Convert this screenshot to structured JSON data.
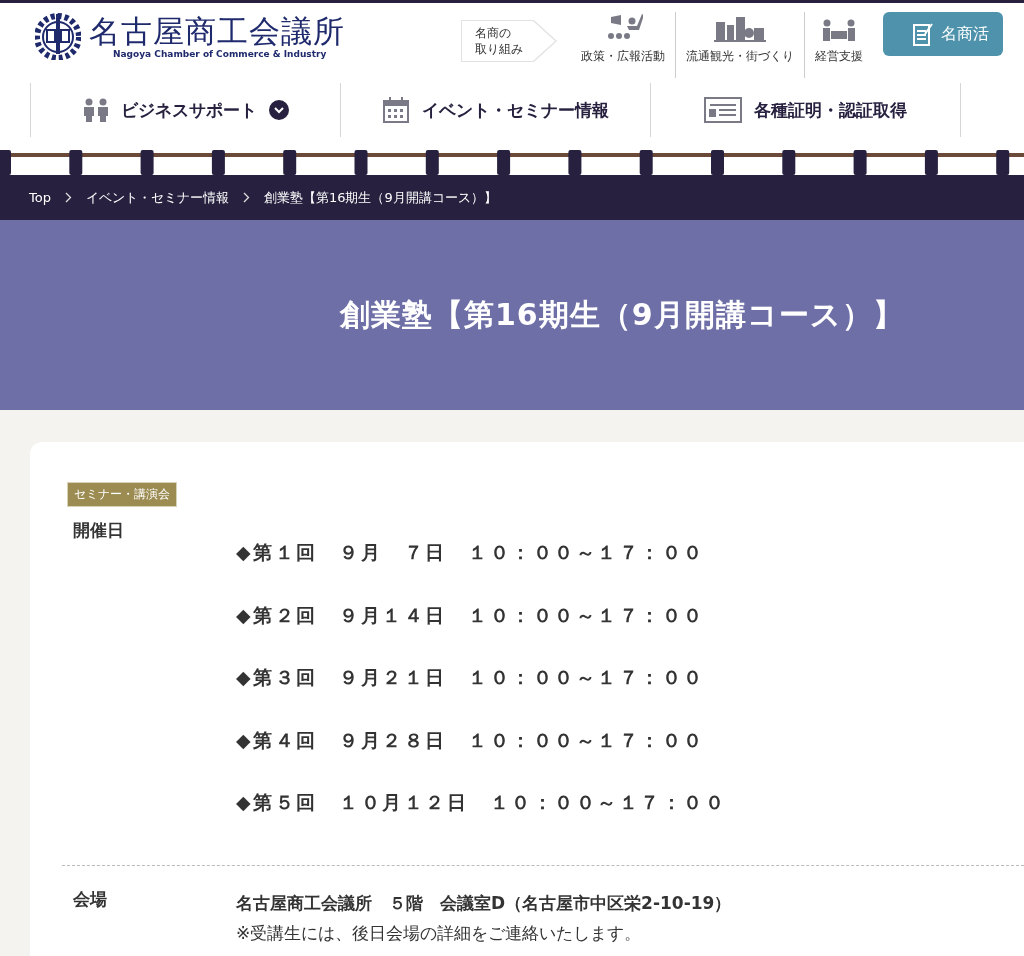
{
  "header": {
    "logo_title": "名古屋商工会議所",
    "logo_subtitle": "Nagoya Chamber of Commerce & Industry",
    "initiatives_label": [
      "名商の",
      "取り組み"
    ],
    "links": [
      {
        "label": "政策・広報活動",
        "kind": "speaker"
      },
      {
        "label": "流通観光・街づくり",
        "kind": "city"
      },
      {
        "label": "経営支援",
        "kind": "consult"
      }
    ],
    "cta": "名商活"
  },
  "nav": [
    {
      "label": "ビジネスサポート",
      "kind": "people",
      "dropdown": true
    },
    {
      "label": "イベント・セミナー情報",
      "kind": "calendar",
      "dropdown": false
    },
    {
      "label": "各種証明・認証取得",
      "kind": "certificate",
      "dropdown": false
    }
  ],
  "breadcrumb": [
    "Top",
    "イベント・セミナー情報",
    "創業塾【第16期生（9月開講コース）】"
  ],
  "page_title": "創業塾【第16期生（9月開講コース）】",
  "event": {
    "category": "セミナー・講演会",
    "details": [
      {
        "label": "開催日",
        "kind": "schedule",
        "lines": [
          "◆第１回　９月　７日　１０：００～１７：００",
          "◆第２回　９月１４日　１０：００～１７：００",
          "◆第３回　９月２１日　１０：００～１７：００",
          "◆第４回　９月２８日　１０：００～１７：００",
          "◆第５回　１０月１２日　１０：００～１７：００"
        ]
      },
      {
        "label": "会場",
        "kind": "text",
        "lines": [
          "名古屋商工会議所　５階　会議室D（名古屋市中区栄2-10-19）",
          "※受講生には、後日会場の詳細をご連絡いたします。"
        ]
      }
    ]
  }
}
